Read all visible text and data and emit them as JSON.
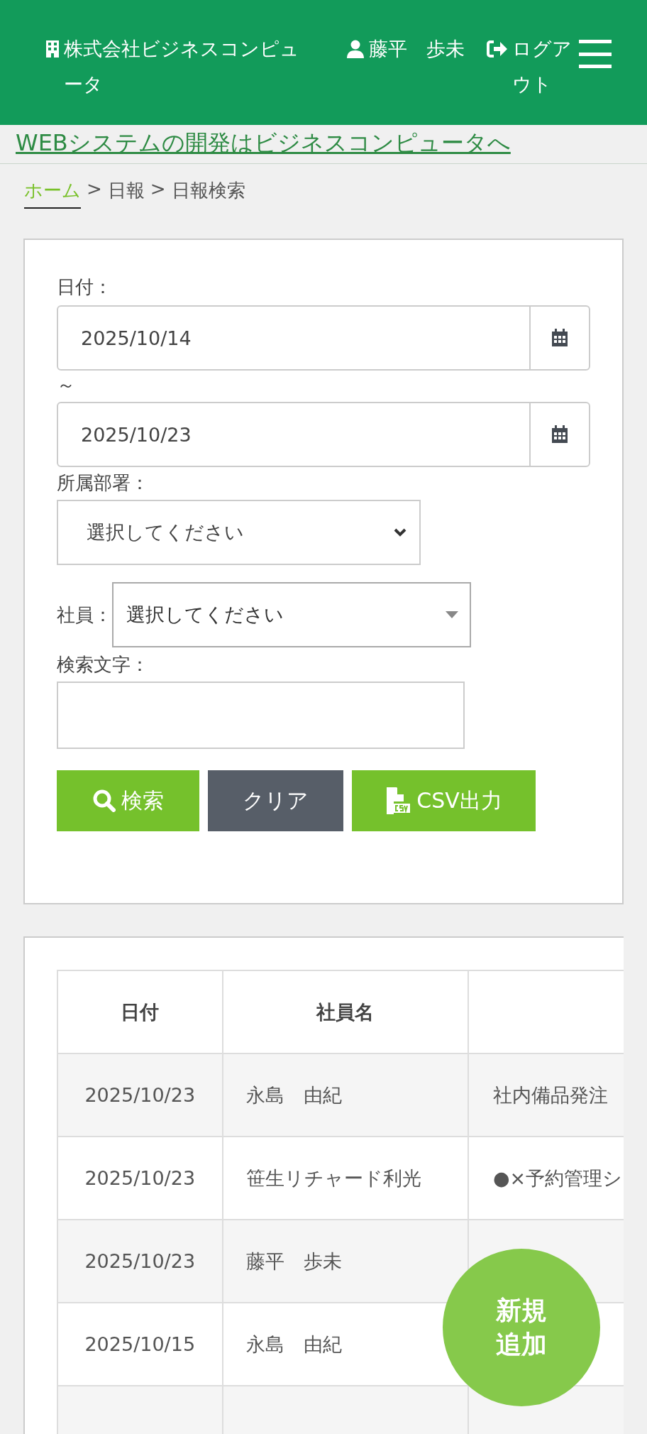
{
  "header": {
    "company": "株式会社ビジネスコンピュータ",
    "user": "藤平　歩未",
    "logout": "ログアウト"
  },
  "banner_link": "WEBシステムの開発はビジネスコンピュータへ",
  "breadcrumb": [
    {
      "label": "ホーム",
      "kind": "link"
    },
    {
      "label": ">",
      "kind": "sep"
    },
    {
      "label": "日報",
      "kind": "text"
    },
    {
      "label": ">",
      "kind": "sep"
    },
    {
      "label": "日報検索",
      "kind": "text"
    }
  ],
  "search_form": {
    "date_label": "日付：",
    "date_from": "2025/10/14",
    "range_sep": "～",
    "date_to": "2025/10/23",
    "department_label": "所属部署：",
    "department_value": "選択してください",
    "employee_label": "社員：",
    "employee_value": "選択してください",
    "keyword_label": "検索文字：",
    "buttons": [
      {
        "label": "検索",
        "kind": "search"
      },
      {
        "label": "クリア",
        "kind": "clear"
      },
      {
        "label": "CSV出力",
        "kind": "csv"
      }
    ]
  },
  "table": {
    "columns": [
      "日付",
      "社員名"
    ],
    "rows": [
      {
        "date": "2025/10/23",
        "name": "永島　由紀",
        "detail": "社内備品発注"
      },
      {
        "date": "2025/10/23",
        "name": "笹生リチャード利光",
        "detail": "●×予約管理シ"
      },
      {
        "date": "2025/10/23",
        "name": "藤平　歩未"
      },
      {
        "date": "2025/10/15",
        "name": "永島　由紀"
      }
    ]
  },
  "fab": "新規追加"
}
